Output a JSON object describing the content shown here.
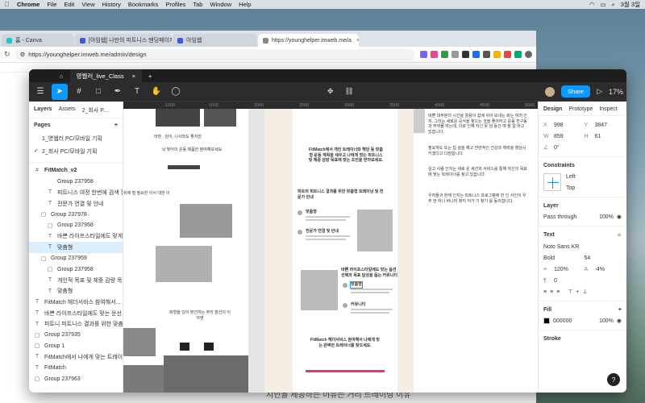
{
  "menubar": {
    "app": "Chrome",
    "items": [
      "File",
      "Edit",
      "View",
      "History",
      "Bookmarks",
      "Profiles",
      "Tab",
      "Window",
      "Help"
    ],
    "clock": "3월 3일"
  },
  "browser": {
    "tabs": [
      {
        "label": "홈 - Canva"
      },
      {
        "label": "[아임웹] 나만의 피트니스 맨딩페이지"
      },
      {
        "label": "아임웹"
      },
      {
        "label": "https://younghelper.imweb.me/a"
      }
    ],
    "url": "https://younghelper.imweb.me/admin/design",
    "page_bottom_text": "지인을 제공하는 이유는 거리 트레이닝 이유"
  },
  "figma": {
    "file_tab": "영웹러_live_Class",
    "share_label": "Share",
    "zoom": "17%",
    "left": {
      "tabs": [
        "Layers",
        "Assets",
        "2_회사 P..."
      ],
      "pages_title": "Pages",
      "pages": [
        {
          "label": "1_영웹러 PC/모바일 기획",
          "current": false
        },
        {
          "label": "2_회사 PC/모바일 기획",
          "current": true
        }
      ],
      "layers": [
        {
          "icon": "#",
          "label": "FitMatch_v2",
          "indent": 0,
          "sel": false,
          "bold": true
        },
        {
          "icon": "",
          "label": "Group 237958",
          "indent": 2,
          "sel": false
        },
        {
          "icon": "T",
          "label": "피트니스 여정 한번에 검색 전문...",
          "indent": 2,
          "sel": false
        },
        {
          "icon": "T",
          "label": "전문가 연결 및 안내",
          "indent": 2,
          "sel": false
        },
        {
          "icon": "▢",
          "label": "Group 237978",
          "indent": 1,
          "sel": false
        },
        {
          "icon": "▢",
          "label": "Group 237958",
          "indent": 2,
          "sel": false
        },
        {
          "icon": "T",
          "label": "바쁜 라이프스타일에도 맞게 설...",
          "indent": 2,
          "sel": false
        },
        {
          "icon": "T",
          "label": "맞춤형",
          "indent": 2,
          "sel": true
        },
        {
          "icon": "▢",
          "label": "Group 237959",
          "indent": 1,
          "sel": false
        },
        {
          "icon": "▢",
          "label": "Group 237958",
          "indent": 2,
          "sel": false
        },
        {
          "icon": "T",
          "label": "개인적 목표 및 체중 감량 목표...",
          "indent": 2,
          "sel": false
        },
        {
          "icon": "T",
          "label": "맞춤형",
          "indent": 2,
          "sel": false
        },
        {
          "icon": "T",
          "label": "FitMatch 헤더서비스 참여해서...",
          "indent": 0,
          "sel": false
        },
        {
          "icon": "T",
          "label": "바쁜 라이프스타일에도 맞는 운선...",
          "indent": 0,
          "sel": false
        },
        {
          "icon": "T",
          "label": "피트니 피트니스 결과를 위한 맞춤형...",
          "indent": 0,
          "sel": false
        },
        {
          "icon": "▢",
          "label": "Group 237935",
          "indent": 0,
          "sel": false
        },
        {
          "icon": "▢",
          "label": "Group 1",
          "indent": 0,
          "sel": false
        },
        {
          "icon": "T",
          "label": "FitMatch에서 나에게 맞는 트레이너...",
          "indent": 0,
          "sel": false
        },
        {
          "icon": "T",
          "label": "FitMatch",
          "indent": 0,
          "sel": false
        },
        {
          "icon": "▢",
          "label": "Group 237963",
          "indent": 0,
          "sel": false
        }
      ]
    },
    "canvas": {
      "ruler": [
        "-1000",
        "1500",
        "2000",
        "2500",
        "3000",
        "3500",
        "4000",
        "4500",
        "5000"
      ],
      "texts": {
        "headline": "FitMatch에서 개인 트레이너와 해당 등 맞춤형 운동 계획을 세우고 나에게 맞는 피트니스 및 체중 감량 목표에 맞는 조언을 받아보세요.",
        "sec1": "피트의 피트니스 결과를 위한 맞춤형 트레이닝 및 전문가 안내",
        "item1": "맞춤형",
        "item2": "전문가 연결 및 안내",
        "sec2": "바쁜 라이프스타일에도 맞는 옵션 선택과 목표 달성을 돕는 커뮤니티",
        "item3": "맞춤형",
        "item4": "커뮤니티",
        "cta": "FitMatch 헤더서비스 참여해서 나에게 맞는 완벽한 트레이너를 찾으세요.",
        "left1": "어떤 , 원이, 나사와도 좋지만",
        "left2": "뇌 맞어의 운동 제품한 참여해보세요",
        "left3": "위에 털 필요한 아서 대한 이",
        "left4": "화형을 있어 맞선하는 무리 점선의 이야엔",
        "right_para1": "바쁜 대부분의 시간을 활용이 쉽에 쉬어 보내는 화는 여러 인지. 그리는 새로운 공식을 찾으는 것을 좋아하고 운동 전구동과 부여물 하는데, 이로 인해 자신 못 넘 동간 에 참 알 하고 있습니다.",
        "right_para2": "필요하도 또는 집 설을 해고 전반적인 건강과 체력을 향상시키겠다고 다짐합니다.",
        "right_para3": "심고 사람 인지는 새로 운 세션과 서비스를 통해 자신의 목표에 맞는 트레이너를 찾고 있습니다.",
        "right_para4": "우려들과 현재 인지는 피트니스 프로그램에 한 인 사인이 우주 한 하나 바니러 찾지 어가 기 찾기 를 동의합니다."
      }
    },
    "right": {
      "tabs": [
        "Design",
        "Prototype",
        "Inspect"
      ],
      "x": "998",
      "y": "3847",
      "w": "859",
      "h": "61",
      "rotation": "0°",
      "constraints_title": "Constraints",
      "constraint_h": "Left",
      "constraint_v": "Top",
      "layer_title": "Layer",
      "blend": "Pass through",
      "opacity": "100%",
      "text_title": "Text",
      "font": "Noto Sans KR",
      "weight": "Bold",
      "size": "54",
      "line_height": "120%",
      "letter_spacing": "-4%",
      "para_spacing": "0",
      "fill_title": "Fill",
      "fill_hex": "000000",
      "fill_opacity": "100%",
      "stroke_title": "Stroke"
    }
  }
}
